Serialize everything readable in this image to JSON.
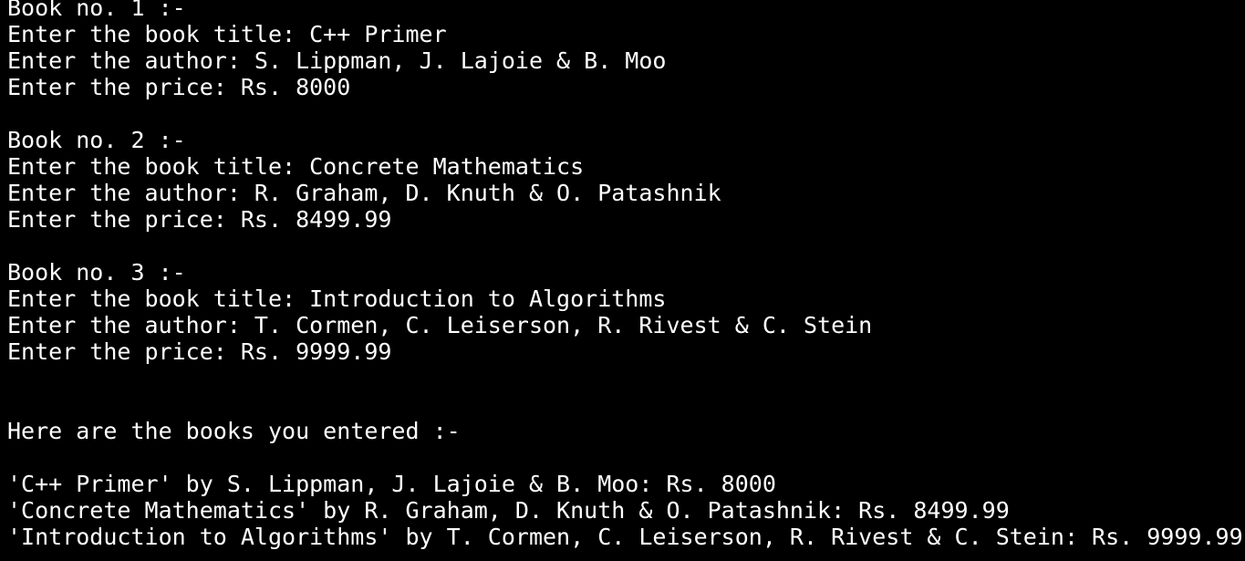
{
  "terminal": {
    "colors": {
      "background": "#000000",
      "foreground": "#ffffff"
    },
    "books": [
      {
        "heading": "Book no. 1 :-",
        "title_line": "Enter the book title: C++ Primer",
        "author_line": "Enter the author: S. Lippman, J. Lajoie & B. Moo",
        "price_line": "Enter the price: Rs. 8000"
      },
      {
        "heading": "Book no. 2 :-",
        "title_line": "Enter the book title: Concrete Mathematics",
        "author_line": "Enter the author: R. Graham, D. Knuth & O. Patashnik",
        "price_line": "Enter the price: Rs. 8499.99"
      },
      {
        "heading": "Book no. 3 :-",
        "title_line": "Enter the book title: Introduction to Algorithms",
        "author_line": "Enter the author: T. Cormen, C. Leiserson, R. Rivest & C. Stein",
        "price_line": "Enter the price: Rs. 9999.99"
      }
    ],
    "summary_heading": "Here are the books you entered :-",
    "summary": [
      "'C++ Primer' by S. Lippman, J. Lajoie & B. Moo: Rs. 8000",
      "'Concrete Mathematics' by R. Graham, D. Knuth & O. Patashnik: Rs. 8499.99",
      "'Introduction to Algorithms' by T. Cormen, C. Leiserson, R. Rivest & C. Stein: Rs. 9999.99"
    ]
  }
}
